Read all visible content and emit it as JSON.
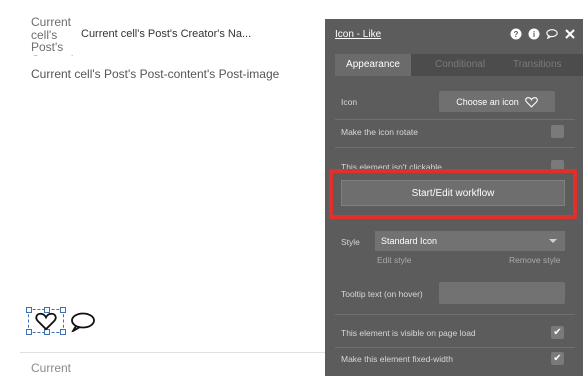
{
  "canvas": {
    "cell_text_small": "Current cell's Post's Creator's",
    "creator_name": "Current cell's Post's Creator's Na...",
    "post_image": "Current cell's Post's Post-content's Post-image",
    "bottom_text": "Current"
  },
  "panel": {
    "title": "Icon - Like",
    "header_icons": [
      "help-icon",
      "info-icon",
      "comment-icon",
      "close-icon"
    ],
    "tabs": [
      {
        "label": "Appearance",
        "active": true
      },
      {
        "label": "Conditional",
        "active": false
      },
      {
        "label": "Transitions",
        "active": false
      }
    ],
    "icon_label": "Icon",
    "choose_icon_label": "Choose an icon",
    "rotate_label": "Make the icon rotate",
    "not_clickable_label": "This element isn't clickable",
    "workflow_button": "Start/Edit workflow",
    "style_label": "Style",
    "style_value": "Standard Icon",
    "edit_style": "Edit style",
    "remove_style": "Remove style",
    "tooltip_label": "Tooltip text (on hover)",
    "visible_label": "This element is visible on page load",
    "fixed_width_label": "Make this element fixed-width",
    "visible_checked": true,
    "fixed_width_checked": true
  },
  "colors": {
    "panel_bg": "#5c5c5c",
    "highlight": "#e0302b",
    "selection": "#3b6fb6"
  }
}
